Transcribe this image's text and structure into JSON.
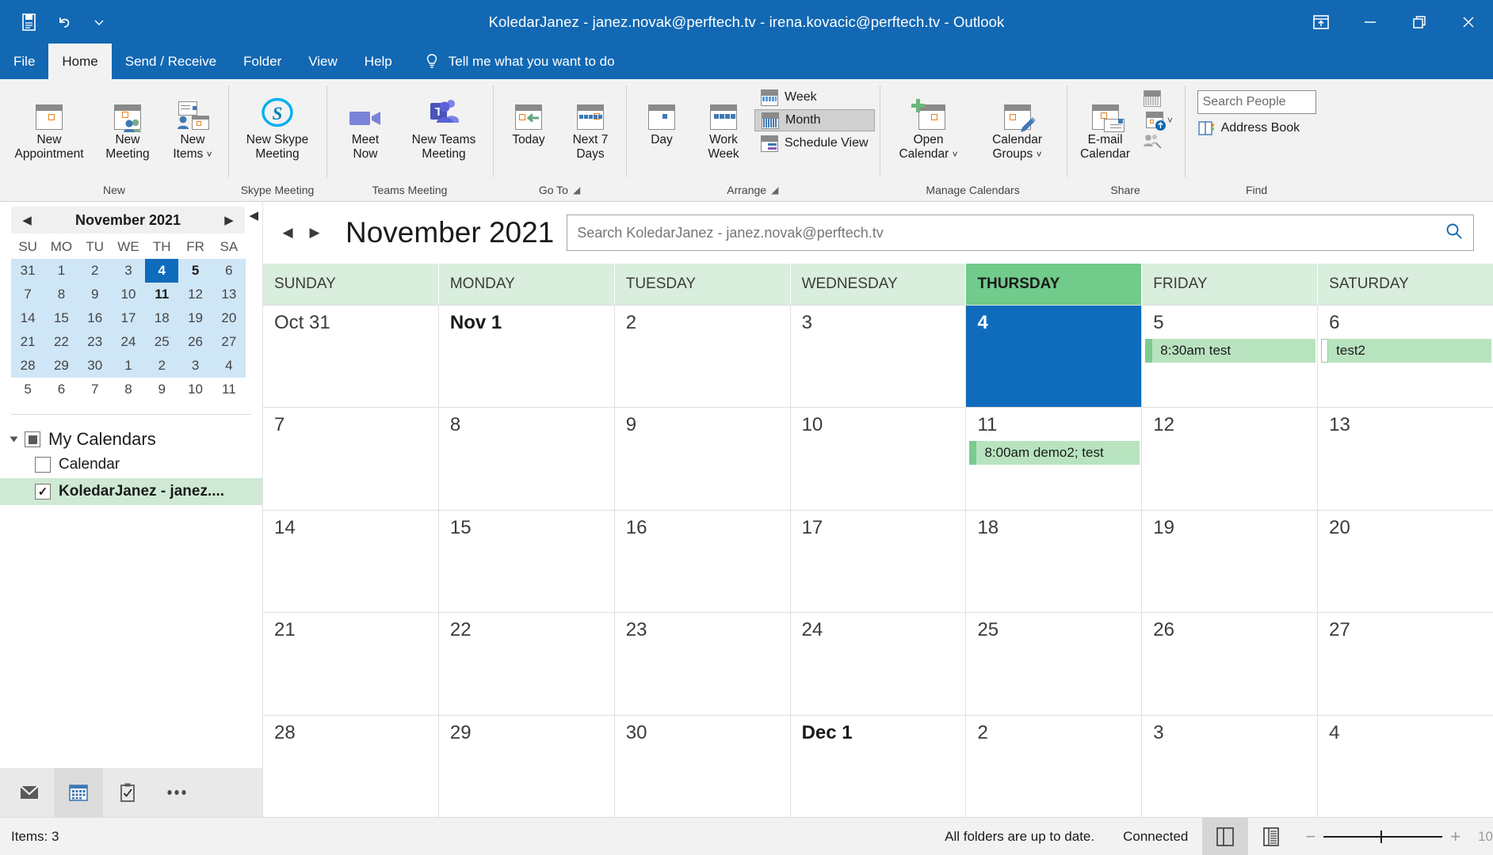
{
  "window": {
    "title": "KoledarJanez - janez.novak@perftech.tv - irena.kovacic@perftech.tv  -  Outlook",
    "quick_access": [
      "save-icon",
      "undo-icon",
      "customize-qat-icon"
    ],
    "controls": [
      "ribbon-display-options-icon",
      "minimize-icon",
      "restore-icon",
      "close-icon"
    ]
  },
  "ribbon": {
    "tabs": [
      {
        "label": "File",
        "active": false
      },
      {
        "label": "Home",
        "active": true
      },
      {
        "label": "Send / Receive",
        "active": false
      },
      {
        "label": "Folder",
        "active": false
      },
      {
        "label": "View",
        "active": false
      },
      {
        "label": "Help",
        "active": false
      }
    ],
    "tell_me": "Tell me what you want to do",
    "groups": [
      {
        "name": "New",
        "buttons": [
          {
            "label_line1": "New",
            "label_line2": "Appointment",
            "icon": "new-appointment-icon"
          },
          {
            "label_line1": "New",
            "label_line2": "Meeting",
            "icon": "new-meeting-icon"
          },
          {
            "label_line1": "New",
            "label_line2": "Items",
            "icon": "new-items-icon",
            "dropdown": true
          }
        ]
      },
      {
        "name": "Skype Meeting",
        "buttons": [
          {
            "label_line1": "New Skype",
            "label_line2": "Meeting",
            "icon": "skype-icon"
          }
        ]
      },
      {
        "name": "Teams Meeting",
        "buttons": [
          {
            "label_line1": "Meet",
            "label_line2": "Now",
            "icon": "meet-now-camera-icon"
          },
          {
            "label_line1": "New Teams",
            "label_line2": "Meeting",
            "icon": "teams-icon"
          }
        ]
      },
      {
        "name": "Go To",
        "dialog_launcher": true,
        "buttons": [
          {
            "label_line1": "Today",
            "label_line2": "",
            "icon": "today-icon"
          },
          {
            "label_line1": "Next 7",
            "label_line2": "Days",
            "icon": "next-7-days-icon"
          }
        ]
      },
      {
        "name": "Arrange",
        "dialog_launcher": true,
        "buttons": [
          {
            "label_line1": "Day",
            "label_line2": "",
            "icon": "day-view-icon"
          },
          {
            "label_line1": "Work",
            "label_line2": "Week",
            "icon": "work-week-view-icon"
          }
        ],
        "small_buttons": [
          {
            "label": "Week",
            "icon": "week-view-icon",
            "selected": false
          },
          {
            "label": "Month",
            "icon": "month-view-icon",
            "selected": true
          },
          {
            "label": "Schedule View",
            "icon": "schedule-view-icon",
            "selected": false
          }
        ]
      },
      {
        "name": "Manage Calendars",
        "buttons": [
          {
            "label_line1": "Open",
            "label_line2": "Calendar",
            "icon": "open-calendar-icon",
            "dropdown": true
          },
          {
            "label_line1": "Calendar",
            "label_line2": "Groups",
            "icon": "calendar-groups-icon",
            "dropdown": true
          }
        ]
      },
      {
        "name": "Share",
        "buttons": [
          {
            "label_line1": "E-mail",
            "label_line2": "Calendar",
            "icon": "email-calendar-icon"
          }
        ],
        "mini_icons": [
          "share-calendar-icon",
          "publish-online-icon",
          "calendar-permissions-icon"
        ]
      },
      {
        "name": "Find",
        "search_people_placeholder": "Search People",
        "address_book_label": "Address Book"
      }
    ]
  },
  "sidebar": {
    "date_nav": {
      "month_label": "November 2021",
      "prev_icon": "prev-month-icon",
      "next_icon": "next-month-icon",
      "collapse_icon": "collapse-pane-icon",
      "weekday_headers": [
        "SU",
        "MO",
        "TU",
        "WE",
        "TH",
        "FR",
        "SA"
      ],
      "weeks": [
        [
          {
            "d": "31",
            "in": true
          },
          {
            "d": "1",
            "in": true
          },
          {
            "d": "2",
            "in": true
          },
          {
            "d": "3",
            "in": true
          },
          {
            "d": "4",
            "in": true,
            "today": true
          },
          {
            "d": "5",
            "in": true,
            "bold": true
          },
          {
            "d": "6",
            "in": true
          }
        ],
        [
          {
            "d": "7",
            "in": true
          },
          {
            "d": "8",
            "in": true
          },
          {
            "d": "9",
            "in": true
          },
          {
            "d": "10",
            "in": true
          },
          {
            "d": "11",
            "in": true,
            "bold": true
          },
          {
            "d": "12",
            "in": true
          },
          {
            "d": "13",
            "in": true
          }
        ],
        [
          {
            "d": "14",
            "in": true
          },
          {
            "d": "15",
            "in": true
          },
          {
            "d": "16",
            "in": true
          },
          {
            "d": "17",
            "in": true
          },
          {
            "d": "18",
            "in": true
          },
          {
            "d": "19",
            "in": true
          },
          {
            "d": "20",
            "in": true
          }
        ],
        [
          {
            "d": "21",
            "in": true
          },
          {
            "d": "22",
            "in": true
          },
          {
            "d": "23",
            "in": true
          },
          {
            "d": "24",
            "in": true
          },
          {
            "d": "25",
            "in": true
          },
          {
            "d": "26",
            "in": true
          },
          {
            "d": "27",
            "in": true
          }
        ],
        [
          {
            "d": "28",
            "in": true
          },
          {
            "d": "29",
            "in": true
          },
          {
            "d": "30",
            "in": true
          },
          {
            "d": "1",
            "in": true
          },
          {
            "d": "2",
            "in": true
          },
          {
            "d": "3",
            "in": true
          },
          {
            "d": "4",
            "in": true
          }
        ],
        [
          {
            "d": "5",
            "in": false
          },
          {
            "d": "6",
            "in": false
          },
          {
            "d": "7",
            "in": false
          },
          {
            "d": "8",
            "in": false
          },
          {
            "d": "9",
            "in": false
          },
          {
            "d": "10",
            "in": false
          },
          {
            "d": "11",
            "in": false
          }
        ]
      ]
    },
    "calendar_group": {
      "title": "My Calendars",
      "items": [
        {
          "label": "Calendar",
          "checked": false,
          "selected": false
        },
        {
          "label": "KoledarJanez - janez....",
          "checked": true,
          "selected": true
        }
      ]
    },
    "nav_buttons": [
      {
        "icon": "mail-icon",
        "active": false
      },
      {
        "icon": "calendar-icon",
        "active": true
      },
      {
        "icon": "tasks-icon",
        "active": false
      },
      {
        "icon": "more-options-icon",
        "active": false
      }
    ]
  },
  "calendar": {
    "prev_icon": "prev-period-icon",
    "next_icon": "next-period-icon",
    "title": "November 2021",
    "search_placeholder": "Search KoledarJanez - janez.novak@perftech.tv",
    "search_value": "",
    "search_icon": "search-icon",
    "weekday_headers": [
      {
        "label": "SUNDAY",
        "today": false
      },
      {
        "label": "MONDAY",
        "today": false
      },
      {
        "label": "TUESDAY",
        "today": false
      },
      {
        "label": "WEDNESDAY",
        "today": false
      },
      {
        "label": "THURSDAY",
        "today": true
      },
      {
        "label": "FRIDAY",
        "today": false
      },
      {
        "label": "SATURDAY",
        "today": false
      }
    ],
    "weeks": [
      [
        {
          "label": "Oct 31",
          "bold": false,
          "selected": false,
          "events": []
        },
        {
          "label": "Nov 1",
          "bold": true,
          "selected": false,
          "events": []
        },
        {
          "label": "2",
          "bold": false,
          "selected": false,
          "events": []
        },
        {
          "label": "3",
          "bold": false,
          "selected": false,
          "events": []
        },
        {
          "label": "4",
          "bold": true,
          "selected": true,
          "events": []
        },
        {
          "label": "5",
          "bold": false,
          "selected": false,
          "events": [
            {
              "text": "8:30am test",
              "bar": "solid"
            }
          ]
        },
        {
          "label": "6",
          "bold": false,
          "selected": false,
          "events": [
            {
              "text": "test2",
              "bar": "hollow"
            }
          ]
        }
      ],
      [
        {
          "label": "7",
          "bold": false,
          "selected": false,
          "events": []
        },
        {
          "label": "8",
          "bold": false,
          "selected": false,
          "events": []
        },
        {
          "label": "9",
          "bold": false,
          "selected": false,
          "events": []
        },
        {
          "label": "10",
          "bold": false,
          "selected": false,
          "events": []
        },
        {
          "label": "11",
          "bold": false,
          "selected": false,
          "events": [
            {
              "text": "8:00am demo2; test",
              "bar": "solid"
            }
          ]
        },
        {
          "label": "12",
          "bold": false,
          "selected": false,
          "events": []
        },
        {
          "label": "13",
          "bold": false,
          "selected": false,
          "events": []
        }
      ],
      [
        {
          "label": "14",
          "bold": false,
          "selected": false,
          "events": []
        },
        {
          "label": "15",
          "bold": false,
          "selected": false,
          "events": []
        },
        {
          "label": "16",
          "bold": false,
          "selected": false,
          "events": []
        },
        {
          "label": "17",
          "bold": false,
          "selected": false,
          "events": []
        },
        {
          "label": "18",
          "bold": false,
          "selected": false,
          "events": []
        },
        {
          "label": "19",
          "bold": false,
          "selected": false,
          "events": []
        },
        {
          "label": "20",
          "bold": false,
          "selected": false,
          "events": []
        }
      ],
      [
        {
          "label": "21",
          "bold": false,
          "selected": false,
          "events": []
        },
        {
          "label": "22",
          "bold": false,
          "selected": false,
          "events": []
        },
        {
          "label": "23",
          "bold": false,
          "selected": false,
          "events": []
        },
        {
          "label": "24",
          "bold": false,
          "selected": false,
          "events": []
        },
        {
          "label": "25",
          "bold": false,
          "selected": false,
          "events": []
        },
        {
          "label": "26",
          "bold": false,
          "selected": false,
          "events": []
        },
        {
          "label": "27",
          "bold": false,
          "selected": false,
          "events": []
        }
      ],
      [
        {
          "label": "28",
          "bold": false,
          "selected": false,
          "events": []
        },
        {
          "label": "29",
          "bold": false,
          "selected": false,
          "events": []
        },
        {
          "label": "30",
          "bold": false,
          "selected": false,
          "events": []
        },
        {
          "label": "Dec 1",
          "bold": true,
          "selected": false,
          "events": []
        },
        {
          "label": "2",
          "bold": false,
          "selected": false,
          "events": []
        },
        {
          "label": "3",
          "bold": false,
          "selected": false,
          "events": []
        },
        {
          "label": "4",
          "bold": false,
          "selected": false,
          "events": []
        }
      ]
    ]
  },
  "status_bar": {
    "items_count": "Items: 3",
    "sync_status": "All folders are up to date.",
    "connection": "Connected",
    "reading_pane_icon": "normal-view-icon",
    "reading_view_icon": "reading-view-icon",
    "zoom_out": "−",
    "zoom_in": "+",
    "zoom_level": "10"
  },
  "colors": {
    "accent": "#1268b3",
    "selected_day": "#0f6cbd",
    "today_header": "#71cb8a",
    "weekday_header": "#d9eedd",
    "event_bg": "#b8e3bf",
    "event_bar": "#7ccb8e",
    "mini_month_bg": "#cfe6f7",
    "selected_calendar_bg": "#cfe9d4"
  }
}
